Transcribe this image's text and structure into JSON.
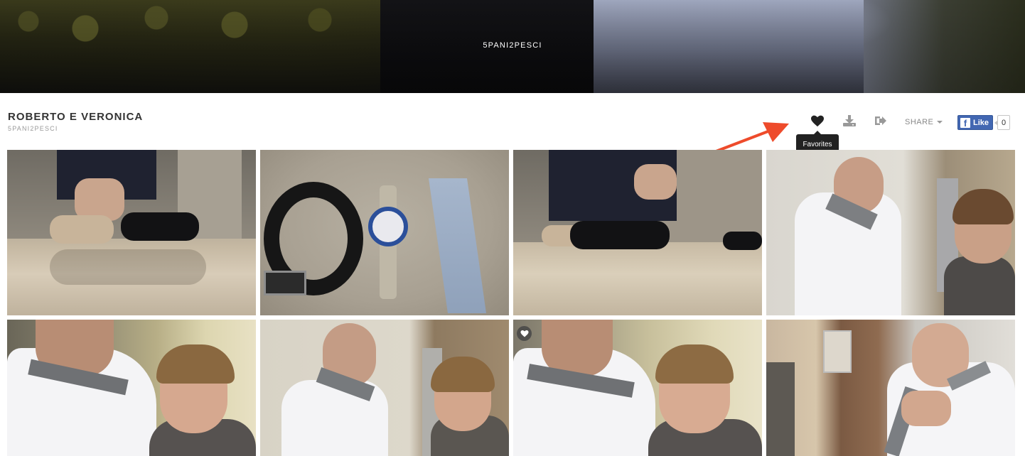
{
  "header": {
    "brand": "5PANI2PESCI"
  },
  "gallery": {
    "title": "ROBERTO E VERONICA",
    "subtitle": "5PANI2PESCI"
  },
  "toolbar": {
    "favorites_tooltip": "Favorites",
    "share_label": "SHARE",
    "like_label": "Like",
    "like_icon": "f",
    "like_count": "0"
  },
  "icons": [
    "heart-icon",
    "download-icon",
    "sign-in-icon",
    "facebook-icon",
    "chevron-down-icon"
  ],
  "colors": {
    "tooltip_bg": "#222222",
    "facebook_blue": "#4267b2",
    "annotation_arrow": "#ee4b2b"
  },
  "photos": [
    {
      "favorited": false
    },
    {
      "favorited": false
    },
    {
      "favorited": false
    },
    {
      "favorited": false
    },
    {
      "favorited": false
    },
    {
      "favorited": false
    },
    {
      "favorited": true
    },
    {
      "favorited": false
    }
  ]
}
